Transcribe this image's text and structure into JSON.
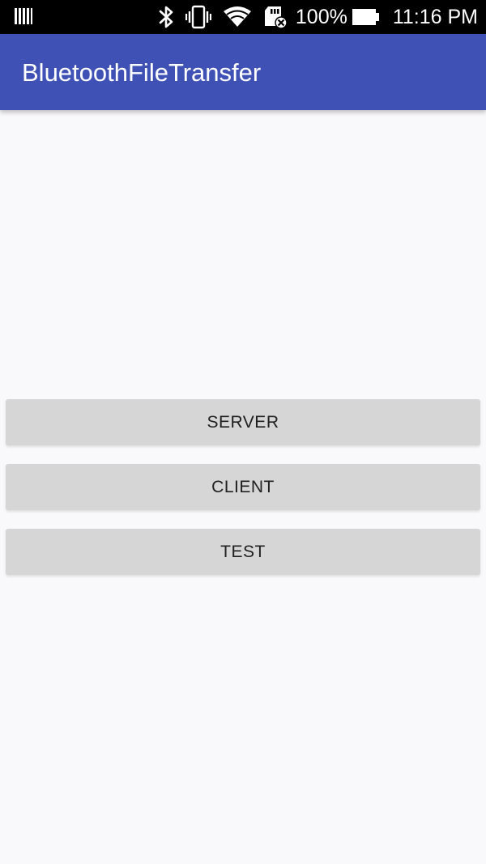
{
  "status_bar": {
    "battery_percent": "100%",
    "time": "11:16 PM",
    "icons": [
      "notification-icon",
      "bluetooth-icon",
      "vibrate-icon",
      "wifi-icon",
      "sd-card-icon",
      "battery-icon"
    ]
  },
  "app_bar": {
    "title": "BluetoothFileTransfer",
    "color": "#3f51b5"
  },
  "buttons": {
    "server": "SERVER",
    "client": "CLIENT",
    "test": "TEST"
  }
}
